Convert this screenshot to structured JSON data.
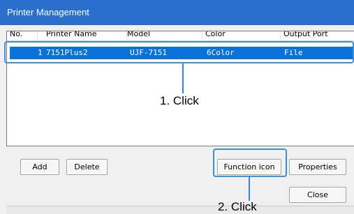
{
  "window": {
    "title": "Printer Management"
  },
  "list": {
    "columns": [
      "No.",
      "Printer Name",
      "Model",
      "Color",
      "Output Port"
    ],
    "rows": [
      {
        "no": "1",
        "name": "7151Plus2",
        "model": "UJF-7151",
        "color": "6Color",
        "port": "File"
      }
    ]
  },
  "buttons": {
    "add": "Add",
    "delete": "Delete",
    "function_icon": "Function icon",
    "properties": "Properties",
    "close": "Close"
  },
  "annotations": {
    "step1": "1. Click",
    "step2": "2. Click",
    "highlight_color": "#3d8fd8"
  },
  "colors": {
    "titlebar": "#2a6fcb",
    "selection": "#0a73d9"
  }
}
